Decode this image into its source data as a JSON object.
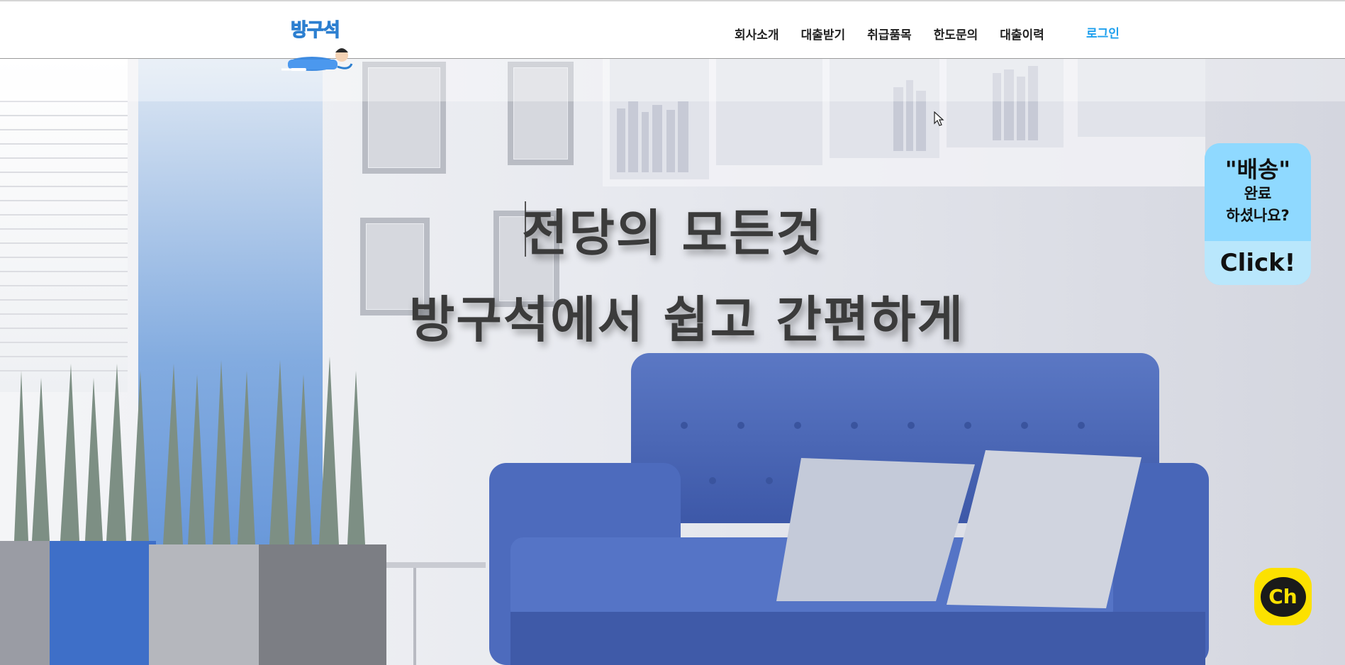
{
  "header": {
    "logo_text": "방구석",
    "nav": [
      "회사소개",
      "대출받기",
      "취급품목",
      "한도문의",
      "대출이력"
    ],
    "login_label": "로그인"
  },
  "hero": {
    "headline_line1": "전당의 모든것",
    "headline_line2": "방구석에서 쉽고 간편하게"
  },
  "delivery_banner": {
    "title": "\"배송\"",
    "line2": "완료",
    "line3": "하셨나요?",
    "cta": "Click!"
  },
  "chat_button": {
    "label": "Ch"
  },
  "colors": {
    "accent_blue": "#1ea0ee",
    "banner_blue": "#8fd9ff",
    "chat_yellow": "#fce100",
    "sofa_blue": "#4a66b8"
  }
}
